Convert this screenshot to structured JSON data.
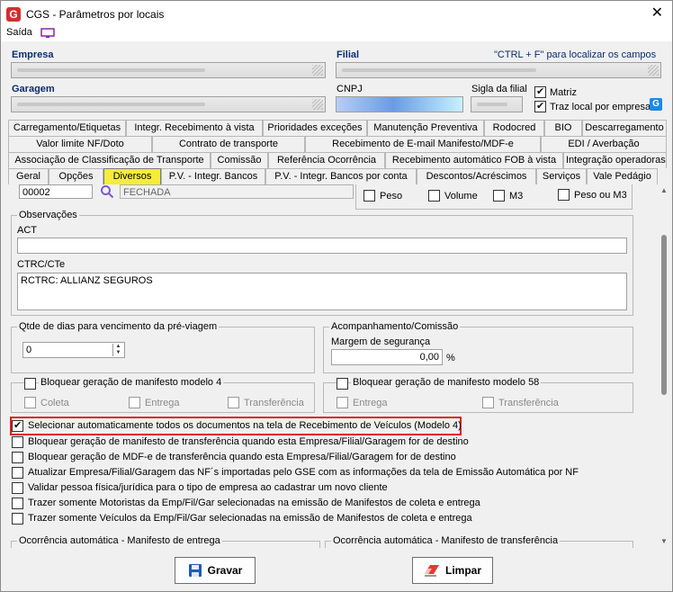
{
  "window": {
    "title": "CGS - Parâmetros por locais",
    "close_symbol": "✕"
  },
  "menu": {
    "saida": "Saída"
  },
  "header": {
    "empresa_label": "Empresa",
    "filial_label": "Filial",
    "hint": "\"CTRL + F\" para localizar os campos",
    "garagem_label": "Garagem",
    "cnpj_label": "CNPJ",
    "sigla_label": "Sigla da filial",
    "matriz_label": "Matriz",
    "traz_local_label": "Traz local por empresa",
    "matriz_checked": true,
    "traz_local_checked": true
  },
  "tabs": {
    "row1": [
      "Carregamento/Etiquetas",
      "Integr. Recebimento à vista",
      "Prioridades exceções",
      "Manutenção Preventiva",
      "Rodocred",
      "BIO",
      "Descarregamento"
    ],
    "row2": [
      "Valor limite NF/Doto",
      "Contrato de transporte",
      "Recebimento de E-mail Manifesto/MDF-e",
      "EDI / Averbação"
    ],
    "row3": [
      "Associação de Classificação de Transporte",
      "Comissão",
      "Referência Ocorrência",
      "Recebimento automático FOB à vista",
      "Integração operadoras"
    ],
    "row4": [
      "Geral",
      "Opções",
      "Diversos",
      "P.V. - Integr. Bancos",
      "P.V. - Integr. Bancos por conta",
      "Descontos/Acréscimos",
      "Serviços",
      "Vale Pedágio"
    ],
    "active": "Diversos"
  },
  "top_partial": {
    "code_value": "00002",
    "status_value": "FECHADA",
    "peso": "Peso",
    "volume": "Volume",
    "m3": "M3",
    "peso_ou_m3": "Peso ou M3"
  },
  "observacoes": {
    "title": "Observações",
    "act_label": "ACT",
    "act_value": "",
    "ctrc_label": "CTRC/CTe",
    "ctrc_value": "RCTRC: ALLIANZ SEGUROS"
  },
  "qtde_dias": {
    "title": "Qtde de dias para vencimento da pré-viagem",
    "value": "0"
  },
  "acompanhamento": {
    "title": "Acompanhamento/Comissão",
    "margem_label": "Margem de segurança",
    "margem_value": "0,00",
    "unit": "%"
  },
  "modelo4": {
    "title": "Bloquear geração de manifesto modelo 4",
    "coleta": "Coleta",
    "entrega": "Entrega",
    "transferencia": "Transferência"
  },
  "modelo58": {
    "title": "Bloquear geração de manifesto modelo 58",
    "entrega": "Entrega",
    "transferencia": "Transferência"
  },
  "options": [
    {
      "label": "Selecionar automaticamente todos os documentos na tela de Recebimento de Veículos (Modelo 4)",
      "checked": true
    },
    {
      "label": "Bloquear geração de manifesto de transferência quando esta Empresa/Filial/Garagem for de destino",
      "checked": false
    },
    {
      "label": "Bloquear geração de MDF-e de transferência quando esta Empresa/Filial/Garagem for de destino",
      "checked": false
    },
    {
      "label": "Atualizar Empresa/Filial/Garagem das NF´s importadas pelo GSE com as informações da tela de Emissão Automática por NF",
      "checked": false
    },
    {
      "label": "Validar pessoa física/jurídica para o tipo de empresa ao cadastrar um novo cliente",
      "checked": false
    },
    {
      "label": "Trazer somente Motoristas da Emp/Fil/Gar selecionadas na emissão de Manifestos de coleta e entrega",
      "checked": false
    },
    {
      "label": "Trazer somente Veículos da Emp/Fil/Gar selecionadas na emissão de Manifestos de coleta e entrega",
      "checked": false
    }
  ],
  "bottom_groups": {
    "left": "Ocorrência automática - Manifesto de entrega",
    "right": "Ocorrência automática - Manifesto de transferência"
  },
  "buttons": {
    "gravar": "Gravar",
    "limpar": "Limpar"
  },
  "colors": {
    "active_tab": "#f6ec3a",
    "highlight": "#e11d1d",
    "label_blue": "#0a2d6e"
  }
}
